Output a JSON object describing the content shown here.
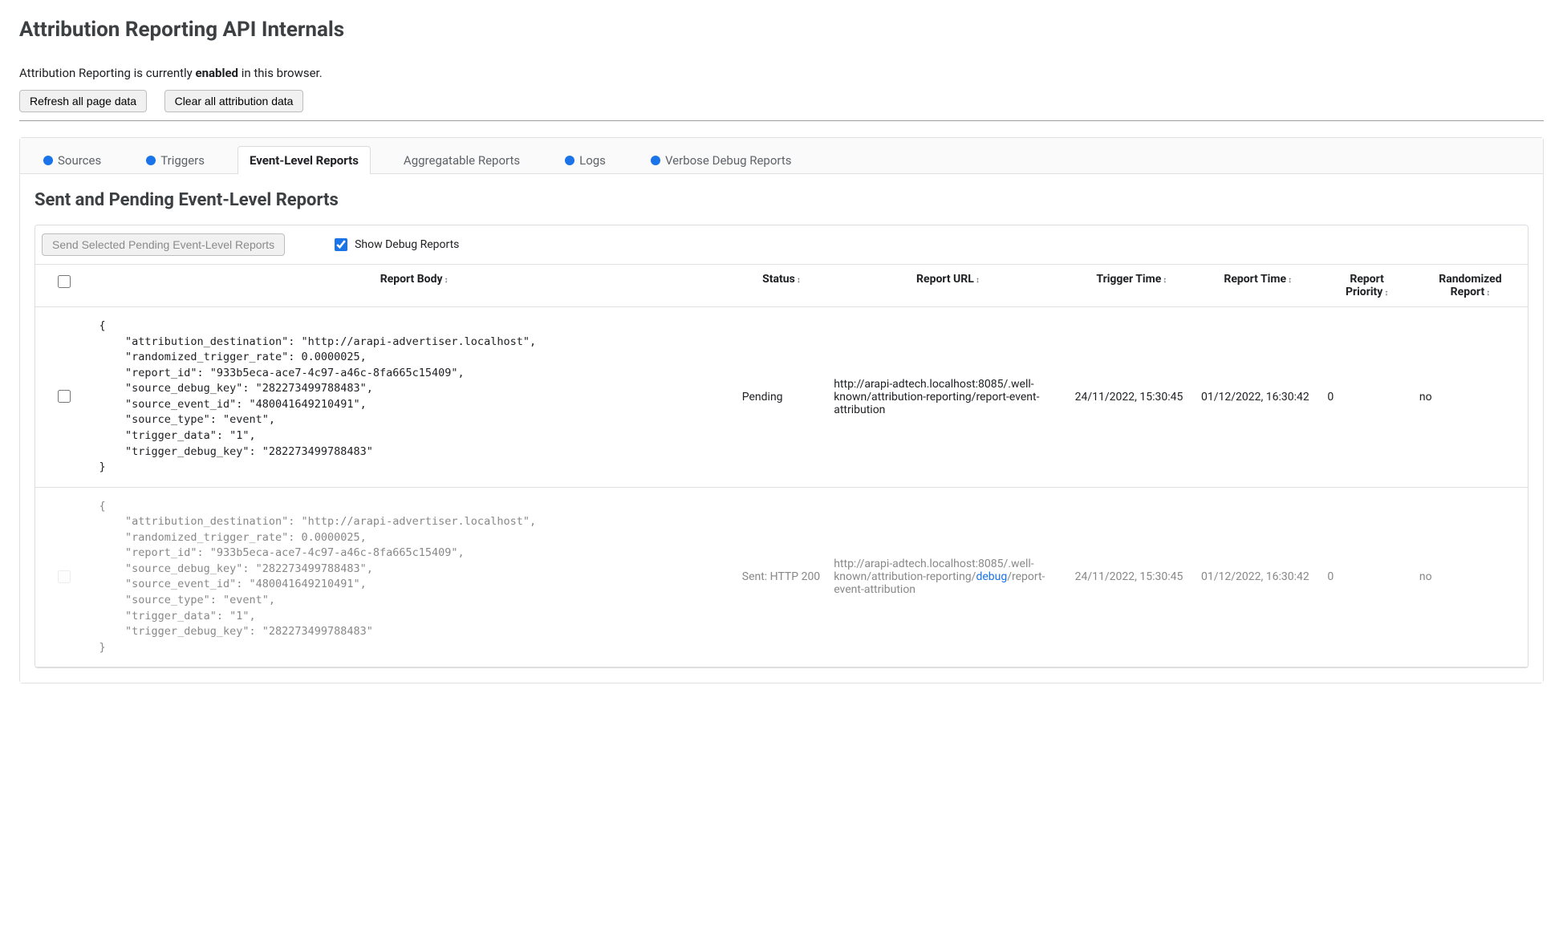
{
  "page": {
    "title": "Attribution Reporting API Internals",
    "status_prefix": "Attribution Reporting is currently ",
    "status_word": "enabled",
    "status_suffix": " in this browser."
  },
  "buttons": {
    "refresh": "Refresh all page data",
    "clear": "Clear all attribution data",
    "send_selected": "Send Selected Pending Event-Level Reports"
  },
  "tabs": [
    {
      "id": "sources",
      "label": "Sources",
      "dot": true,
      "active": false
    },
    {
      "id": "triggers",
      "label": "Triggers",
      "dot": true,
      "active": false
    },
    {
      "id": "event-reports",
      "label": "Event-Level Reports",
      "dot": false,
      "active": true
    },
    {
      "id": "aggregatable",
      "label": "Aggregatable Reports",
      "dot": false,
      "active": false
    },
    {
      "id": "logs",
      "label": "Logs",
      "dot": true,
      "active": false
    },
    {
      "id": "verbose",
      "label": "Verbose Debug Reports",
      "dot": true,
      "active": false
    }
  ],
  "panel": {
    "heading": "Sent and Pending Event-Level Reports",
    "show_debug_label": "Show Debug Reports",
    "show_debug_checked": true,
    "columns": {
      "body": "Report Body",
      "status": "Status",
      "url": "Report URL",
      "trigger_time": "Trigger Time",
      "report_time": "Report Time",
      "priority": "Report Priority",
      "randomized": "Randomized Report"
    },
    "rows": [
      {
        "selectable": true,
        "checked": false,
        "body": "{\n    \"attribution_destination\": \"http://arapi-advertiser.localhost\",\n    \"randomized_trigger_rate\": 0.0000025,\n    \"report_id\": \"933b5eca-ace7-4c97-a46c-8fa665c15409\",\n    \"source_debug_key\": \"282273499788483\",\n    \"source_event_id\": \"480041649210491\",\n    \"source_type\": \"event\",\n    \"trigger_data\": \"1\",\n    \"trigger_debug_key\": \"282273499788483\"\n}",
        "status": "Pending",
        "url_parts": [
          "http://arapi-adtech.localhost:8085/.well-known/attribution-reporting/report-event-attribution"
        ],
        "trigger_time": "24/11/2022, 15:30:45",
        "report_time": "01/12/2022, 16:30:42",
        "priority": "0",
        "randomized": "no"
      },
      {
        "selectable": false,
        "checked": false,
        "body": "{\n    \"attribution_destination\": \"http://arapi-advertiser.localhost\",\n    \"randomized_trigger_rate\": 0.0000025,\n    \"report_id\": \"933b5eca-ace7-4c97-a46c-8fa665c15409\",\n    \"source_debug_key\": \"282273499788483\",\n    \"source_event_id\": \"480041649210491\",\n    \"source_type\": \"event\",\n    \"trigger_data\": \"1\",\n    \"trigger_debug_key\": \"282273499788483\"\n}",
        "status": "Sent: HTTP 200",
        "url_parts": [
          "http://arapi-adtech.localhost:8085/.well-known/attribution-reporting/",
          "debug",
          "/report-event-attribution"
        ],
        "trigger_time": "24/11/2022, 15:30:45",
        "report_time": "01/12/2022, 16:30:42",
        "priority": "0",
        "randomized": "no"
      }
    ]
  }
}
